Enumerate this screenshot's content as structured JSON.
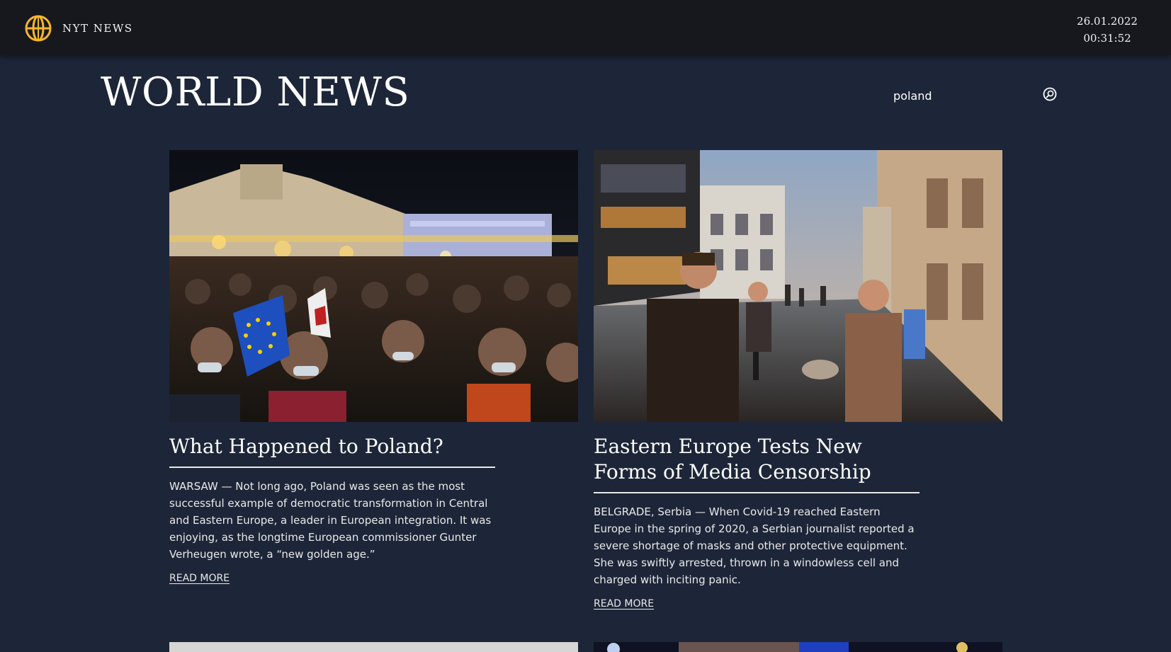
{
  "header": {
    "brand": "NYT NEWS",
    "date": "26.01.2022",
    "time": "00:31:52",
    "logo_color": "#f5b530"
  },
  "page": {
    "title": "WORLD NEWS"
  },
  "search": {
    "value": "poland"
  },
  "articles": [
    {
      "title": "What Happened to Poland?",
      "text": "WARSAW — Not long ago, Poland was seen as the most successful example of democratic transformation in Central and Eastern Europe, a leader in European integration. It was enjoying, as the longtime European commissioner Gunter Verheugen wrote, a “new golden age.”",
      "link": "READ MORE",
      "image": "night protest crowd with EU flags in Warsaw"
    },
    {
      "title": "Eastern Europe Tests New Forms of Media Censorship",
      "text": "BELGRADE, Serbia — When Covid-19 reached Eastern Europe in the spring of 2020, a Serbian journalist reported a severe shortage of masks and other protective equipment. She was swiftly arrested, thrown in a windowless cell and charged with inciting panic.",
      "link": "READ MORE",
      "image": "evening pedestrian street in Belgrade"
    }
  ]
}
